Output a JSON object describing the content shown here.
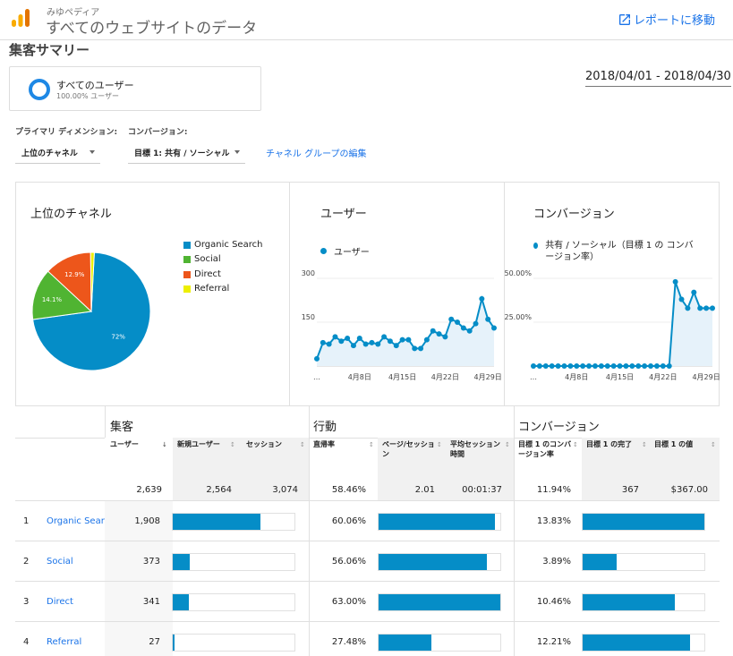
{
  "header": {
    "property": "みゆペディア",
    "view": "すべてのウェブサイトのデータ",
    "goto_report": "レポートに移動",
    "brand_color": "#f9ab00"
  },
  "page_title": "集客サマリー",
  "segment": {
    "name": "すべてのユーザー",
    "sub": "100.00% ユーザー"
  },
  "date_range": "2018/04/01 - 2018/04/30",
  "controls": {
    "primary_dimension_label": "プライマリ ディメンション:",
    "conversion_label": "コンバージョン:",
    "primary_dimension_value": "上位のチャネル",
    "conversion_value": "目標 1: 共有 / ソーシャル",
    "edit_link": "チャネル グループの編集"
  },
  "accent_color": "#058dc7",
  "charts": {
    "pie": {
      "title": "上位のチャネル",
      "legend": [
        "Organic Search",
        "Social",
        "Direct",
        "Referral"
      ]
    },
    "users": {
      "title": "ユーザー",
      "legend": "ユーザー"
    },
    "conversion": {
      "title": "コンバージョン",
      "legend": "共有 / ソーシャル（目標 1 の コンバージョン率）"
    }
  },
  "chart_data": [
    {
      "type": "pie",
      "categories": [
        "Organic Search",
        "Social",
        "Direct",
        "Referral"
      ],
      "values": [
        72,
        14.1,
        12.9,
        1
      ],
      "slice_labels": [
        "72%",
        "14.1%",
        "12.9%",
        ""
      ],
      "colors": [
        "#058dc7",
        "#50b432",
        "#ed561b",
        "#edef00"
      ]
    },
    {
      "type": "area",
      "x": [
        "4/1",
        "4/2",
        "4/3",
        "4/4",
        "4/5",
        "4/6",
        "4/7",
        "4/8",
        "4/9",
        "4/10",
        "4/11",
        "4/12",
        "4/13",
        "4/14",
        "4/15",
        "4/16",
        "4/17",
        "4/18",
        "4/19",
        "4/20",
        "4/21",
        "4/22",
        "4/23",
        "4/24",
        "4/25",
        "4/26",
        "4/27",
        "4/28",
        "4/29",
        "4/30"
      ],
      "x_tick_labels": [
        "…",
        "4月8日",
        "4月15日",
        "4月22日",
        "4月29日"
      ],
      "values": [
        25,
        80,
        75,
        100,
        85,
        95,
        70,
        95,
        75,
        80,
        75,
        100,
        85,
        70,
        90,
        90,
        60,
        60,
        90,
        120,
        110,
        100,
        160,
        150,
        130,
        120,
        145,
        230,
        160,
        130
      ],
      "y_ticks": [
        150,
        300
      ],
      "ylim": [
        0,
        300
      ],
      "series_color": "#058dc7"
    },
    {
      "type": "area",
      "x": [
        "4/1",
        "4/2",
        "4/3",
        "4/4",
        "4/5",
        "4/6",
        "4/7",
        "4/8",
        "4/9",
        "4/10",
        "4/11",
        "4/12",
        "4/13",
        "4/14",
        "4/15",
        "4/16",
        "4/17",
        "4/18",
        "4/19",
        "4/20",
        "4/21",
        "4/22",
        "4/23",
        "4/24",
        "4/25",
        "4/26",
        "4/27",
        "4/28",
        "4/29",
        "4/30"
      ],
      "x_tick_labels": [
        "…",
        "4月8日",
        "4月15日",
        "4月22日",
        "4月29日"
      ],
      "values": [
        0,
        0,
        0,
        0,
        0,
        0,
        0,
        0,
        0,
        0,
        0,
        0,
        0,
        0,
        0,
        0,
        0,
        0,
        0,
        0,
        0,
        0,
        0,
        48,
        38,
        33,
        42,
        33,
        33,
        33
      ],
      "y_ticks": [
        "25.00%",
        "50.00%"
      ],
      "ylim": [
        0,
        50
      ],
      "series_color": "#058dc7"
    }
  ],
  "table": {
    "groups": [
      "集客",
      "行動",
      "コンバージョン"
    ],
    "columns": [
      "ユーザー",
      "新規ユーザー",
      "セッション",
      "直帰率",
      "ページ/セッション",
      "平均セッション時間",
      "目標 1 のコンバージョン率",
      "目標 1 の完了",
      "目標 1 の値"
    ],
    "totals": [
      "2,639",
      "2,564",
      "3,074",
      "58.46%",
      "2.01",
      "00:01:37",
      "11.94%",
      "367",
      "$367.00"
    ],
    "rows": [
      {
        "num": "1",
        "channel": "Organic Search",
        "users": "1,908",
        "bounce": "60.06%",
        "conv": "13.83%",
        "users_bar": 0.723,
        "bounce_bar": 0.953,
        "conv_bar": 1.0
      },
      {
        "num": "2",
        "channel": "Social",
        "users": "373",
        "bounce": "56.06%",
        "conv": "3.89%",
        "users_bar": 0.141,
        "bounce_bar": 0.89,
        "conv_bar": 0.281
      },
      {
        "num": "3",
        "channel": "Direct",
        "users": "341",
        "bounce": "63.00%",
        "conv": "10.46%",
        "users_bar": 0.129,
        "bounce_bar": 1.0,
        "conv_bar": 0.756
      },
      {
        "num": "4",
        "channel": "Referral",
        "users": "27",
        "bounce": "27.48%",
        "conv": "12.21%",
        "users_bar": 0.014,
        "bounce_bar": 0.436,
        "conv_bar": 0.883
      }
    ]
  }
}
